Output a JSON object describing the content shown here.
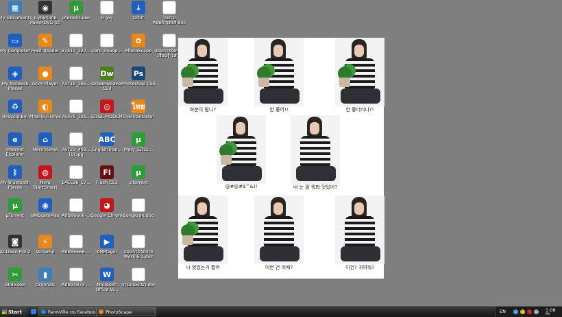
{
  "desktop": {
    "icons": [
      {
        "label": "My Documents",
        "glyph": "▦",
        "style": "g-folder"
      },
      {
        "label": "CyberLink PowerDVD 10",
        "glyph": "◉",
        "style": "g-dark g-round"
      },
      {
        "label": "utorrent.exe",
        "glyph": "µ",
        "style": "g-green"
      },
      {
        "label": "b.jpg",
        "glyph": "▤",
        "style": "g-doc"
      },
      {
        "label": "Orbit",
        "glyph": "↓",
        "style": "g-blue g-round"
      },
      {
        "label": "ใบงานคอมพิวเตอร์.doc",
        "glyph": "W",
        "style": "g-word"
      },
      {
        "label": "My Computer",
        "glyph": "▭",
        "style": "g-blue"
      },
      {
        "label": "Foxit Reader",
        "glyph": "✎",
        "style": "g-orange"
      },
      {
        "label": "37317_127...",
        "glyph": "▤",
        "style": "g-doc"
      },
      {
        "label": "safe_image...",
        "glyph": "▤",
        "style": "g-doc"
      },
      {
        "label": "PhotoScape",
        "glyph": "✿",
        "style": "g-orange g-round"
      },
      {
        "label": "แผนการจัดการเรียนรู้ 1ส...",
        "glyph": "W",
        "style": "g-word"
      },
      {
        "label": "My Network Places",
        "glyph": "◈",
        "style": "g-blue"
      },
      {
        "label": "GOM Player",
        "glyph": "●",
        "style": "g-orange g-round"
      },
      {
        "label": "73719_165...",
        "glyph": "▤",
        "style": "g-doc"
      },
      {
        "label": "Dreamweaver CS3",
        "glyph": "Dw",
        "style": "g-dw"
      },
      {
        "label": "Photoshop CS3",
        "glyph": "Ps",
        "style": "g-ps"
      },
      {
        "label": "Recycle Bin",
        "glyph": "♻",
        "style": "g-blue"
      },
      {
        "label": "Mozilla Firefox",
        "glyph": "◐",
        "style": "g-orange g-round"
      },
      {
        "label": "76376_121...",
        "glyph": "▤",
        "style": "g-doc"
      },
      {
        "label": "EDGE MODEM",
        "glyph": "◎",
        "style": "g-red"
      },
      {
        "label": "ThaiTranslator",
        "glyph": "ไทย",
        "style": "g-orange"
      },
      {
        "label": "Internet Explorer",
        "glyph": "e",
        "style": "g-blue g-round"
      },
      {
        "label": "Nero Home",
        "glyph": "⌂",
        "style": "g-blue"
      },
      {
        "label": "76723_492... (1).jpg",
        "glyph": "▤",
        "style": "g-doc"
      },
      {
        "label": "EnglishTran...",
        "glyph": "ABC",
        "style": "g-blue"
      },
      {
        "label": "Mary_EDL1...",
        "glyph": "µ",
        "style": "g-green"
      },
      {
        "label": "My Bluetooth Places",
        "glyph": "ᛒ",
        "style": "g-blue g-round"
      },
      {
        "label": "Nero StartSmart",
        "glyph": "◍",
        "style": "g-red g-round"
      },
      {
        "label": "145526_17...",
        "glyph": "▤",
        "style": "g-doc"
      },
      {
        "label": "Flash CS3",
        "glyph": "Fl",
        "style": "g-fl"
      },
      {
        "label": "v.torrent",
        "glyph": "µ",
        "style": "g-green"
      },
      {
        "label": "µTorrent",
        "glyph": "µ",
        "style": "g-green"
      },
      {
        "label": "WebcamMax",
        "glyph": "◉",
        "style": "g-blue g-round"
      },
      {
        "label": "A9B86666-...",
        "glyph": "▤",
        "style": "g-doc"
      },
      {
        "label": "Google Chrome",
        "glyph": "◕",
        "style": "g-red g-round"
      },
      {
        "label": "Songkran.doc",
        "glyph": "W",
        "style": "g-word"
      },
      {
        "label": "ACDSee Pro 2",
        "glyph": "◙",
        "style": "g-dark"
      },
      {
        "label": "Winamp",
        "glyph": "⚡",
        "style": "g-orange"
      },
      {
        "label": "A9B86666-...",
        "glyph": "▤",
        "style": "g-doc"
      },
      {
        "label": "KMPlayer",
        "glyph": "▶",
        "style": "g-blue"
      },
      {
        "label": "แผนการจัดการ Work 6.1.doc",
        "glyph": "W",
        "style": "g-word"
      },
      {
        "label": "ahdv.exe",
        "glyph": "✂",
        "style": "g-green"
      },
      {
        "label": "Originals",
        "glyph": "▮",
        "style": "g-folder"
      },
      {
        "label": "A9B94873-...",
        "glyph": "▤",
        "style": "g-doc"
      },
      {
        "label": "Microsoft Office W...",
        "glyph": "W",
        "style": "g-blue"
      },
      {
        "label": "งานแนะแนว.doc",
        "glyph": "W",
        "style": "g-word"
      }
    ]
  },
  "photo": {
    "captions": [
      "화분이 됩니?",
      "안 좋어!!",
      "안 좋더러나?!",
      "@#@#$^&!!",
      "내 는 말 뭐봐 멋있어?",
      "나 멋있는거 짤어",
      "이런 건 어때?",
      "이건? 귀여워?"
    ]
  },
  "taskbar": {
    "start_label": "Start",
    "tasks": [
      {
        "label": "FarmVille บน Faceboo...",
        "color": "#2d7fd3"
      },
      {
        "label": "PhotoScape",
        "color": "#e8881b"
      }
    ],
    "tray": {
      "language": "EN",
      "time": "1:08",
      "ampm": "PM"
    }
  }
}
